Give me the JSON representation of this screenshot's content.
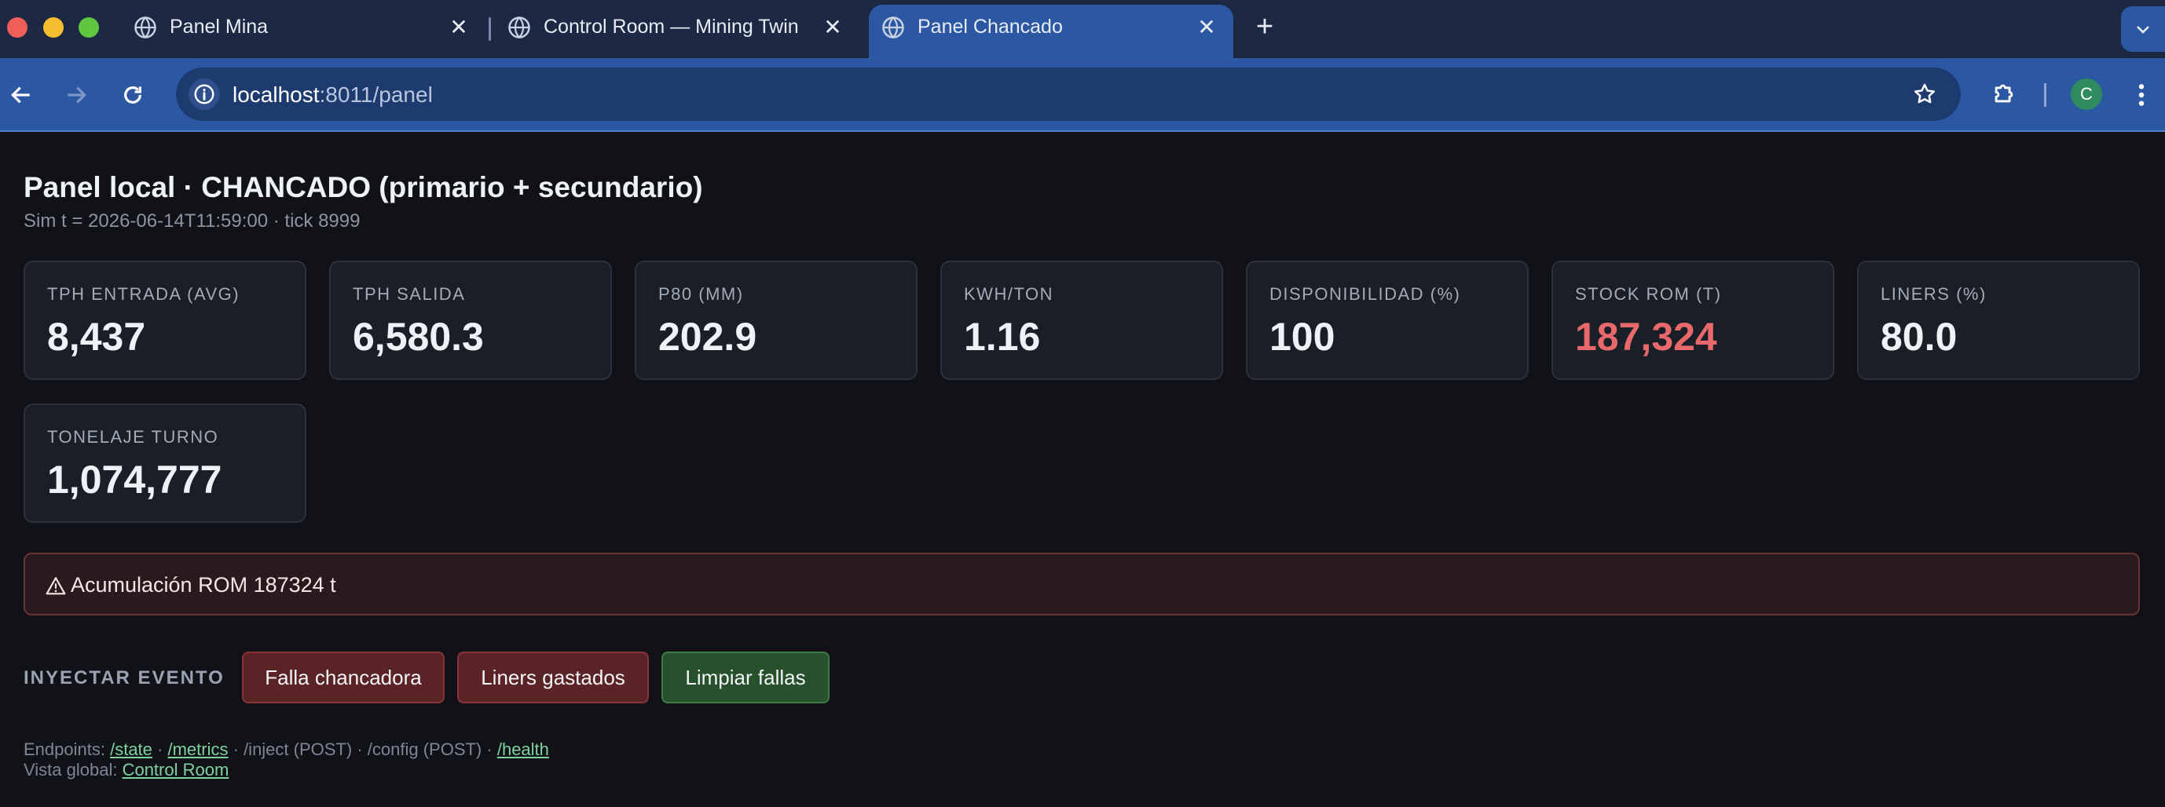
{
  "browser": {
    "tabs": [
      {
        "title": "Panel Mina"
      },
      {
        "title": "Control Room — Mining Twin"
      },
      {
        "title": "Panel Chancado",
        "active": true
      }
    ],
    "url_host": "localhost",
    "url_rest": ":8011/panel",
    "profile_initial": "C"
  },
  "page": {
    "title": "Panel local · CHANCADO (primario + secundario)",
    "subtitle": "Sim t = 2026-06-14T11:59:00 · tick 8999"
  },
  "kpis": [
    {
      "label": "TPH ENTRADA (AVG)",
      "value": "8,437"
    },
    {
      "label": "TPH SALIDA",
      "value": "6,580.3"
    },
    {
      "label": "P80 (MM)",
      "value": "202.9"
    },
    {
      "label": "KWH/TON",
      "value": "1.16"
    },
    {
      "label": "DISPONIBILIDAD (%)",
      "value": "100"
    },
    {
      "label": "STOCK ROM (T)",
      "value": "187,324",
      "alert": true
    },
    {
      "label": "LINERS (%)",
      "value": "80.0"
    },
    {
      "label": "TONELAJE TURNO",
      "value": "1,074,777"
    }
  ],
  "alert": {
    "text": "Acumulación ROM 187324 t",
    "icon": "warning-icon"
  },
  "inject": {
    "label": "INYECTAR EVENTO",
    "buttons": {
      "fault": "Falla chancadora",
      "liners": "Liners gastados",
      "clear": "Limpiar fallas"
    }
  },
  "footer": {
    "endpoints_label": "Endpoints:",
    "state": "/state",
    "metrics": "/metrics",
    "inject": "/inject (POST)",
    "config": "/config (POST)",
    "health": "/health",
    "sep": "·",
    "global_label": "Vista global:",
    "control_room": "Control Room"
  },
  "colors": {
    "alert_value": "#e8696b",
    "accent": "#2c58a3",
    "danger_btn": "#5a2326",
    "ok_btn": "#26512c"
  }
}
